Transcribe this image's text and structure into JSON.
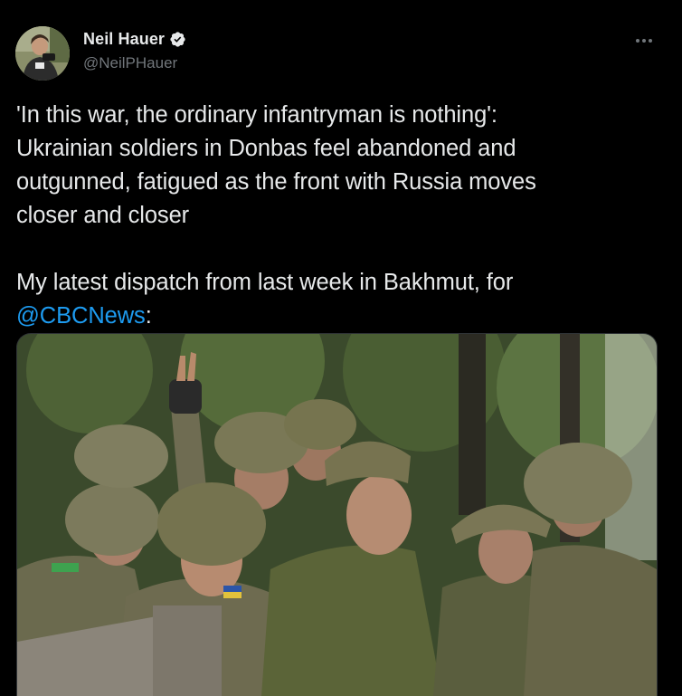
{
  "author": {
    "display_name": "Neil Hauer",
    "handle": "@NeilPHauer",
    "verified": true,
    "avatar_icon": "profile-photo"
  },
  "actions": {
    "more_icon": "more-horizontal-icon"
  },
  "tweet": {
    "line1": "'In this war, the ordinary infantryman is nothing':",
    "line2": "Ukrainian soldiers in Donbas feel abandoned and",
    "line3": "outgunned, fatigued as the front with Russia moves",
    "line4": "closer and closer",
    "line5": "My latest dispatch from last week in Bakhmut, for",
    "mention": "@CBCNews",
    "after_mention": ":"
  },
  "media": {
    "type": "photo",
    "subject": "soldiers-in-helmets-photo"
  },
  "colors": {
    "background": "#000000",
    "text": "#e7e9ea",
    "secondary": "#71767b",
    "link": "#1d9bf0",
    "verified": "#e7e9ea"
  }
}
